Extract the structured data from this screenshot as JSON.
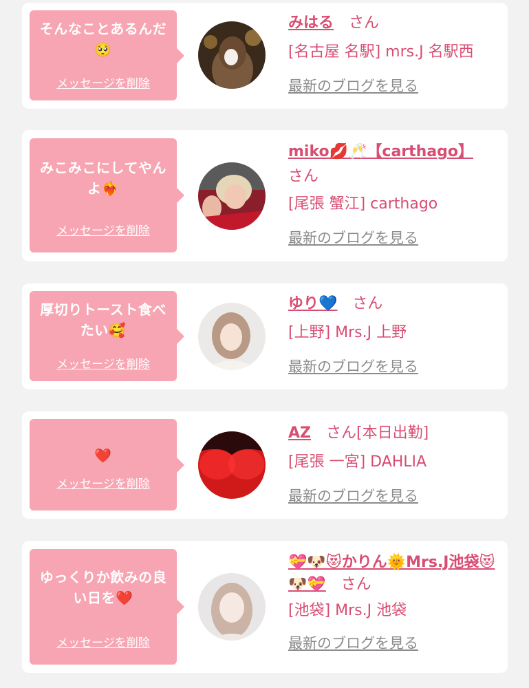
{
  "cards": [
    {
      "message": "そんなことあるんだ🥺",
      "delete_label": "メッセージを削除",
      "avatar_icon": "girl-photo-night",
      "name": "みはる",
      "honorific": "さん",
      "shop": "[名古屋 名駅] mrs.J 名駅西",
      "blog_label": "最新のブログを見る"
    },
    {
      "message": "みこみこにしてやんよ❤️‍🔥",
      "delete_label": "メッセージを削除",
      "avatar_icon": "girl-photo-blonde",
      "name": "miko💋🥂【carthago】",
      "honorific": "さん",
      "shop": "[尾張 蟹江] carthago",
      "blog_label": "最新のブログを見る"
    },
    {
      "message": "厚切りトースト食べたい🥰",
      "delete_label": "メッセージを削除",
      "avatar_icon": "girl-photo-light",
      "name": "ゆり💙",
      "honorific": "さん",
      "shop": "[上野] Mrs.J 上野",
      "blog_label": "最新のブログを見る"
    },
    {
      "message": "❤️",
      "delete_label": "メッセージを削除",
      "avatar_icon": "red-heart-photo",
      "name": "AZ",
      "honorific": "さん",
      "badge": "[本日出勤]",
      "shop": "[尾張 一宮] DAHLIA",
      "blog_label": "最新のブログを見る"
    },
    {
      "message": "ゆっくりか飲みの良い日を❤️",
      "delete_label": "メッセージを削除",
      "avatar_icon": "girl-photo-grey",
      "name": "💝🐶😻かりん🌞Mrs.J池袋😻🐶💝",
      "honorific": "さん",
      "shop": "[池袋] Mrs.J 池袋",
      "blog_label": "最新のブログを見る"
    }
  ],
  "colors": {
    "accent": "#d84d72",
    "bubble": "#f7a5b2",
    "background": "#f2f2f3",
    "card": "#ffffff",
    "muted": "#8c8c8c"
  }
}
